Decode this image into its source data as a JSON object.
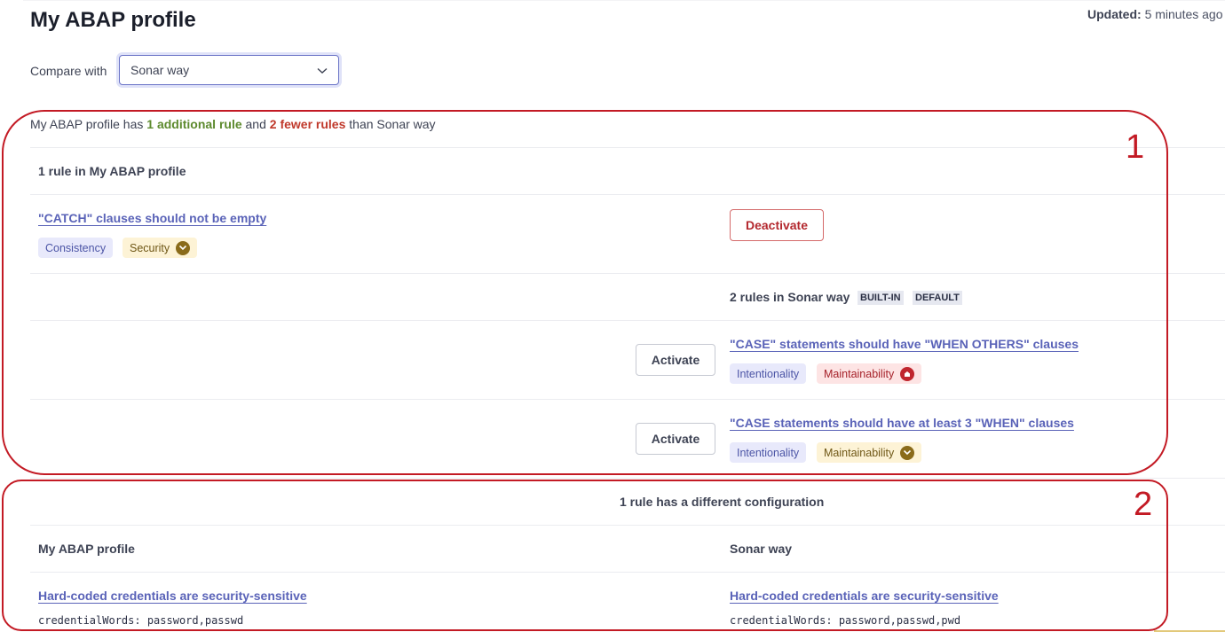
{
  "page": {
    "title": "My ABAP profile",
    "updated_label": "Updated:",
    "updated_value": "5 minutes ago"
  },
  "compare": {
    "label": "Compare with",
    "selected": "Sonar way"
  },
  "summary": {
    "prefix": "My ABAP profile has",
    "additional": "1 additional rule",
    "middle": "and",
    "fewer": "2 fewer rules",
    "suffix": "than Sonar way"
  },
  "left_only": {
    "heading": "1 rule in My ABAP profile",
    "rules": [
      {
        "name": "\"CATCH\" clauses should not be empty",
        "tags": [
          "Consistency",
          "Security"
        ],
        "action": "Deactivate"
      }
    ]
  },
  "right_only": {
    "heading": "2 rules in Sonar way",
    "badges": [
      "BUILT-IN",
      "DEFAULT"
    ],
    "rules": [
      {
        "name": "\"CASE\" statements should have \"WHEN OTHERS\" clauses",
        "tags": [
          "Intentionality",
          "Maintainability"
        ],
        "action": "Activate"
      },
      {
        "name": "\"CASE statements should have at least 3 \"WHEN\" clauses",
        "tags": [
          "Intentionality",
          "Maintainability"
        ],
        "action": "Activate"
      }
    ]
  },
  "diff": {
    "heading": "1 rule has a different configuration",
    "left_col": "My ABAP profile",
    "right_col": "Sonar way",
    "left_rule": "Hard-coded credentials are security-sensitive",
    "left_param": "credentialWords: password,passwd",
    "right_rule": "Hard-coded credentials are security-sensitive",
    "right_param": "credentialWords: password,passwd,pwd"
  },
  "annotations": [
    "1",
    "2"
  ],
  "colors": {
    "accent": "#5a63b8",
    "annotation": "#c31a24",
    "added": "#5d8a2e",
    "removed": "#c0392b"
  },
  "icons": {
    "select": "chevron-down-icon",
    "severity_medium": "chevron-down-circle-icon",
    "severity_high": "high-severity-icon"
  }
}
